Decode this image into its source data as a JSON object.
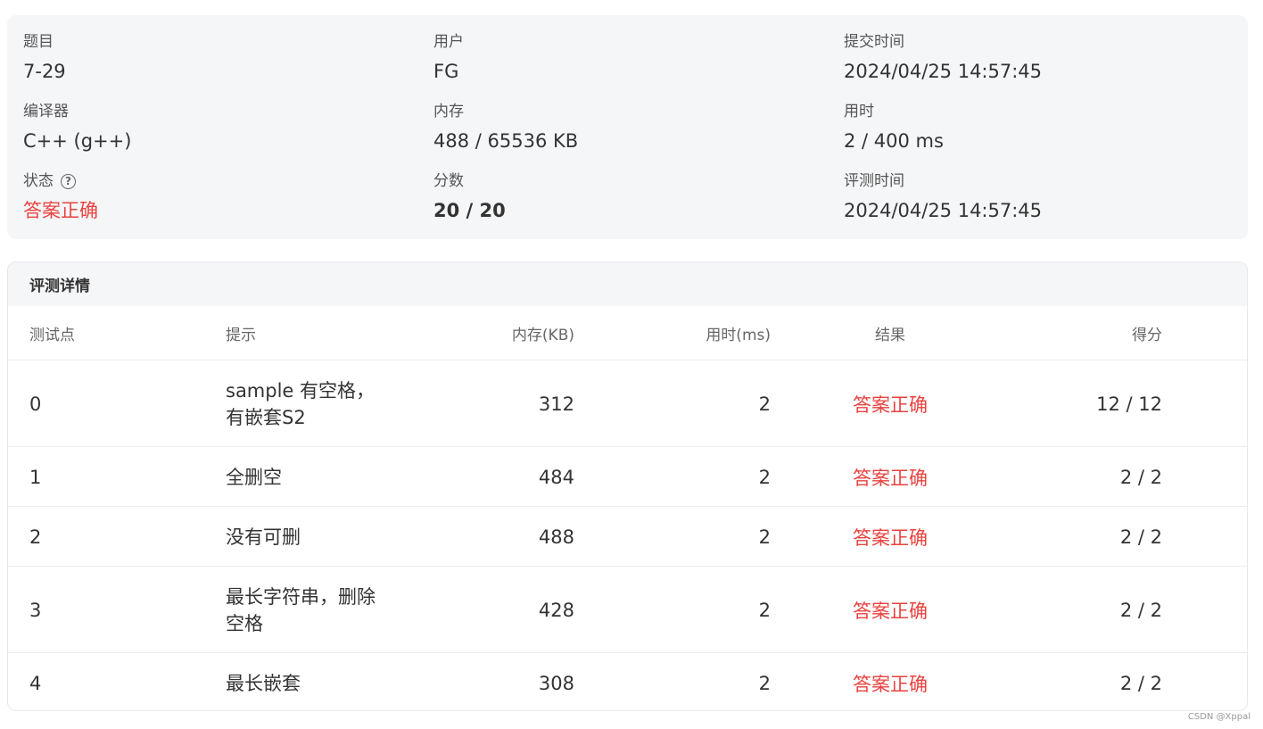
{
  "summary": {
    "problem_label": "题目",
    "problem_value": "7-29",
    "user_label": "用户",
    "user_value": "FG",
    "submit_time_label": "提交时间",
    "submit_time_value": "2024/04/25 14:57:45",
    "compiler_label": "编译器",
    "compiler_value": "C++ (g++)",
    "memory_label": "内存",
    "memory_value": "488 / 65536 KB",
    "time_label": "用时",
    "time_value": "2 / 400 ms",
    "status_label": "状态",
    "status_value": "答案正确",
    "score_label": "分数",
    "score_value": "20 / 20",
    "judge_time_label": "评测时间",
    "judge_time_value": "2024/04/25 14:57:45",
    "help_icon": "?"
  },
  "details": {
    "title": "评测详情",
    "columns": {
      "case": "测试点",
      "hint": "提示",
      "memory": "内存(KB)",
      "time": "用时(ms)",
      "result": "结果",
      "score": "得分"
    },
    "rows": [
      {
        "case": "0",
        "hint": "sample 有空格，有嵌套S2",
        "memory": "312",
        "time": "2",
        "result": "答案正确",
        "score": "12 / 12"
      },
      {
        "case": "1",
        "hint": "全删空",
        "memory": "484",
        "time": "2",
        "result": "答案正确",
        "score": "2 / 2"
      },
      {
        "case": "2",
        "hint": "没有可删",
        "memory": "488",
        "time": "2",
        "result": "答案正确",
        "score": "2 / 2"
      },
      {
        "case": "3",
        "hint": "最长字符串，删除空格",
        "memory": "428",
        "time": "2",
        "result": "答案正确",
        "score": "2 / 2"
      },
      {
        "case": "4",
        "hint": "最长嵌套",
        "memory": "308",
        "time": "2",
        "result": "答案正确",
        "score": "2 / 2"
      }
    ]
  },
  "watermark": "CSDN @Xppal",
  "colors": {
    "accepted": "#e8433f",
    "panel_bg": "#f5f6f8"
  }
}
